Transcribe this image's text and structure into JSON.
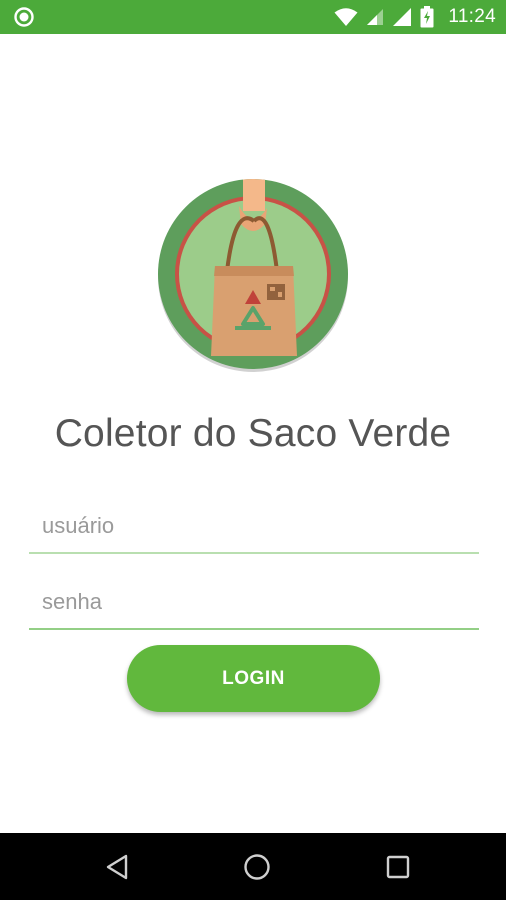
{
  "status_bar": {
    "time": "11:24",
    "background": "#4caa3a",
    "icons": [
      "app-notification-icon",
      "wifi-icon",
      "signal-icon",
      "signal-icon",
      "battery-charging-icon"
    ]
  },
  "logo": {
    "icon": "recycle-bag-logo-icon"
  },
  "app": {
    "title": "Coletor do Saco Verde"
  },
  "login_form": {
    "username_placeholder": "usuário",
    "password_placeholder": "senha",
    "login_label": "LOGIN",
    "accent": "#61b83d"
  },
  "nav_bar": {
    "buttons": [
      "back-icon",
      "home-icon",
      "recents-icon"
    ]
  }
}
